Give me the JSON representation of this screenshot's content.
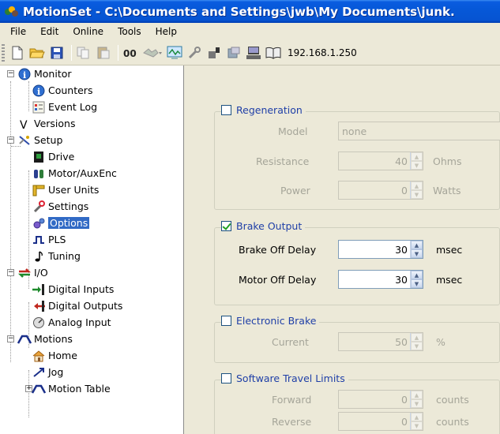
{
  "window": {
    "title": "MotionSet - C:\\Documents and Settings\\jwb\\My Documents\\junk.",
    "accent": "#0658d8"
  },
  "menubar": {
    "items": [
      "File",
      "Edit",
      "Online",
      "Tools",
      "Help"
    ]
  },
  "toolbar": {
    "buttons": [
      "new-icon",
      "open-icon",
      "save-icon",
      "copy-icon",
      "paste-icon",
      "connect-icon",
      "disconnect-icon",
      "scope-icon",
      "tools-icon",
      "download-icon",
      "upload-icon",
      "computer-icon",
      "manual-icon"
    ],
    "ip_address": "192.168.1.250"
  },
  "tree": {
    "monitor": "Monitor",
    "counters": "Counters",
    "event_log": "Event Log",
    "versions": "Versions",
    "setup": "Setup",
    "drive": "Drive",
    "motor_auxenc": "Motor/AuxEnc",
    "user_units": "User Units",
    "settings": "Settings",
    "options": "Options",
    "pls": "PLS",
    "tuning": "Tuning",
    "io": "I/O",
    "digital_inputs": "Digital Inputs",
    "digital_outputs": "Digital Outputs",
    "analog_input": "Analog Input",
    "motions": "Motions",
    "home": "Home",
    "jog": "Jog",
    "motion_table": "Motion Table",
    "selected": "Options"
  },
  "regeneration": {
    "title": "Regeneration",
    "checked": false,
    "model_label": "Model",
    "model_value": "none",
    "resistance_label": "Resistance",
    "resistance_value": "40",
    "resistance_unit": "Ohms",
    "power_label": "Power",
    "power_value": "0",
    "power_unit": "Watts"
  },
  "brake_output": {
    "title": "Brake Output",
    "checked": true,
    "brake_off_delay_label": "Brake Off Delay",
    "brake_off_delay_value": "30",
    "motor_off_delay_label": "Motor Off Delay",
    "motor_off_delay_value": "30",
    "unit": "msec"
  },
  "electronic_brake": {
    "title": "Electronic Brake",
    "checked": false,
    "current_label": "Current",
    "current_value": "50",
    "current_unit": "%"
  },
  "software_travel_limits": {
    "title": "Software Travel Limits",
    "checked": false,
    "forward_label": "Forward",
    "forward_value": "0",
    "reverse_label": "Reverse",
    "reverse_value": "0",
    "unit": "counts"
  }
}
